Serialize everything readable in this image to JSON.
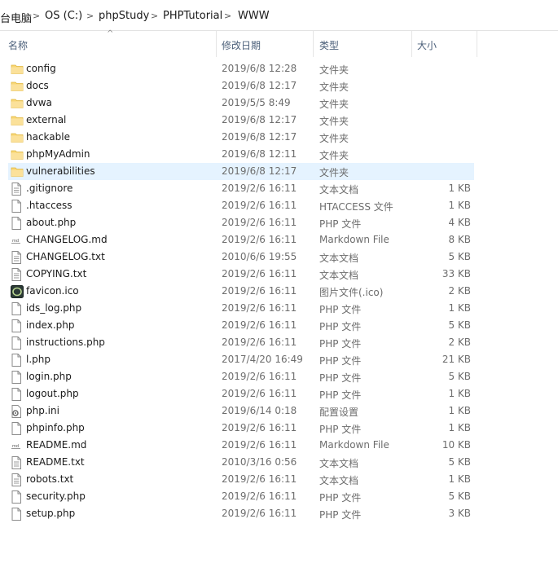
{
  "breadcrumb": {
    "items": [
      "台电脑",
      "OS (C:)",
      "phpStudy",
      "PHPTutorial",
      "WWW"
    ],
    "separator": ">"
  },
  "columns": {
    "name": "名称",
    "date": "修改日期",
    "type": "类型",
    "size": "大小",
    "sort_indicator": "^"
  },
  "files": [
    {
      "name": "config",
      "date": "2019/6/8 12:28",
      "type": "文件夹",
      "size": "",
      "icon": "folder-icon"
    },
    {
      "name": "docs",
      "date": "2019/6/8 12:17",
      "type": "文件夹",
      "size": "",
      "icon": "folder-icon"
    },
    {
      "name": "dvwa",
      "date": "2019/5/5 8:49",
      "type": "文件夹",
      "size": "",
      "icon": "folder-icon"
    },
    {
      "name": "external",
      "date": "2019/6/8 12:17",
      "type": "文件夹",
      "size": "",
      "icon": "folder-icon"
    },
    {
      "name": "hackable",
      "date": "2019/6/8 12:17",
      "type": "文件夹",
      "size": "",
      "icon": "folder-icon"
    },
    {
      "name": "phpMyAdmin",
      "date": "2019/6/8 12:11",
      "type": "文件夹",
      "size": "",
      "icon": "folder-icon"
    },
    {
      "name": "vulnerabilities",
      "date": "2019/6/8 12:17",
      "type": "文件夹",
      "size": "",
      "icon": "folder-icon",
      "selected": true
    },
    {
      "name": ".gitignore",
      "date": "2019/2/6 16:11",
      "type": "文本文档",
      "size": "1 KB",
      "icon": "text-file-icon"
    },
    {
      "name": ".htaccess",
      "date": "2019/2/6 16:11",
      "type": "HTACCESS 文件",
      "size": "1 KB",
      "icon": "file-icon"
    },
    {
      "name": "about.php",
      "date": "2019/2/6 16:11",
      "type": "PHP 文件",
      "size": "4 KB",
      "icon": "file-icon"
    },
    {
      "name": "CHANGELOG.md",
      "date": "2019/2/6 16:11",
      "type": "Markdown File",
      "size": "8 KB",
      "icon": "markdown-file-icon"
    },
    {
      "name": "CHANGELOG.txt",
      "date": "2010/6/6 19:55",
      "type": "文本文档",
      "size": "5 KB",
      "icon": "text-file-icon"
    },
    {
      "name": "COPYING.txt",
      "date": "2019/2/6 16:11",
      "type": "文本文档",
      "size": "33 KB",
      "icon": "text-file-icon"
    },
    {
      "name": "favicon.ico",
      "date": "2019/2/6 16:11",
      "type": "图片文件(.ico)",
      "size": "2 KB",
      "icon": "image-file-icon"
    },
    {
      "name": "ids_log.php",
      "date": "2019/2/6 16:11",
      "type": "PHP 文件",
      "size": "1 KB",
      "icon": "file-icon"
    },
    {
      "name": "index.php",
      "date": "2019/2/6 16:11",
      "type": "PHP 文件",
      "size": "5 KB",
      "icon": "file-icon"
    },
    {
      "name": "instructions.php",
      "date": "2019/2/6 16:11",
      "type": "PHP 文件",
      "size": "2 KB",
      "icon": "file-icon"
    },
    {
      "name": "l.php",
      "date": "2017/4/20 16:49",
      "type": "PHP 文件",
      "size": "21 KB",
      "icon": "file-icon"
    },
    {
      "name": "login.php",
      "date": "2019/2/6 16:11",
      "type": "PHP 文件",
      "size": "5 KB",
      "icon": "file-icon"
    },
    {
      "name": "logout.php",
      "date": "2019/2/6 16:11",
      "type": "PHP 文件",
      "size": "1 KB",
      "icon": "file-icon"
    },
    {
      "name": "php.ini",
      "date": "2019/6/14 0:18",
      "type": "配置设置",
      "size": "1 KB",
      "icon": "config-file-icon"
    },
    {
      "name": "phpinfo.php",
      "date": "2019/2/6 16:11",
      "type": "PHP 文件",
      "size": "1 KB",
      "icon": "file-icon"
    },
    {
      "name": "README.md",
      "date": "2019/2/6 16:11",
      "type": "Markdown File",
      "size": "10 KB",
      "icon": "markdown-file-icon"
    },
    {
      "name": "README.txt",
      "date": "2010/3/16 0:56",
      "type": "文本文档",
      "size": "5 KB",
      "icon": "text-file-icon"
    },
    {
      "name": "robots.txt",
      "date": "2019/2/6 16:11",
      "type": "文本文档",
      "size": "1 KB",
      "icon": "text-file-icon"
    },
    {
      "name": "security.php",
      "date": "2019/2/6 16:11",
      "type": "PHP 文件",
      "size": "5 KB",
      "icon": "file-icon"
    },
    {
      "name": "setup.php",
      "date": "2019/2/6 16:11",
      "type": "PHP 文件",
      "size": "3 KB",
      "icon": "file-icon"
    }
  ],
  "colors": {
    "selection": "#e5f3ff",
    "folder": "#f8d775",
    "header_text": "#4c607a"
  }
}
